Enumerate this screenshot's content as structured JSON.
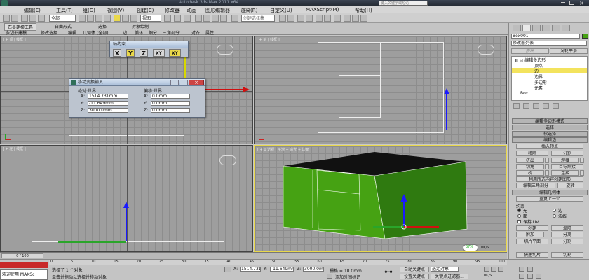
{
  "app": {
    "title": "Autodesk 3ds Max  2011 x64",
    "search_placeholder": "键入关键字或短语"
  },
  "menu": [
    "编辑(E)",
    "工具(T)",
    "组(G)",
    "视图(V)",
    "创建(C)",
    "修改器",
    "动画",
    "图形编辑器",
    "渲染(R)",
    "自定义(U)",
    "MAXScript(M)",
    "帮助(H)"
  ],
  "toolbar": {
    "filter_value": "全部",
    "view_value": "视图",
    "selection_set_placeholder": "创建选择集"
  },
  "ribbon": {
    "tabs": [
      "石墨建模工具",
      "自由形式",
      "选择",
      "对象绘制"
    ],
    "subtabs": [
      "多边形建模",
      "修改选择",
      "编辑",
      "几何体 (全部)",
      "边",
      "循环",
      "细分",
      "三角剖分",
      "对齐",
      "属性"
    ]
  },
  "viewports": [
    {
      "label": "[ + 顶 | 线框 ]"
    },
    {
      "label": "[ + 前 | 线框 ]"
    },
    {
      "label": "[ + 左 | 线框 ]"
    },
    {
      "label": "[ + 0 透视 | 平滑 + 高光 + 边面 ]"
    }
  ],
  "axis_constraints": {
    "title": "轴约束",
    "buttons": [
      "X",
      "Y",
      "Z",
      "XY",
      "XY"
    ]
  },
  "transform_dialog": {
    "title": "移动变换输入",
    "absolute_title": "绝对:世界",
    "offset_title": "偏移:世界",
    "absolute": [
      {
        "axis": "X:",
        "value": "1514.731mm"
      },
      {
        "axis": "Y:",
        "value": "-11.649mm"
      },
      {
        "axis": "Z:",
        "value": "3000.0mm"
      }
    ],
    "offset": [
      {
        "axis": "X:",
        "value": "0.0mm"
      },
      {
        "axis": "Y:",
        "value": "0.0mm"
      },
      {
        "axis": "Z:",
        "value": "0.0mm"
      }
    ]
  },
  "command_panel": {
    "object_name": "Box001",
    "modifier_list": "修改器列表",
    "tab_labels": [
      "挤出",
      "涡轮平滑"
    ],
    "stack": [
      {
        "label": "编辑多边形",
        "level": 0,
        "selected": false
      },
      {
        "label": "顶点",
        "level": 1,
        "selected": false
      },
      {
        "label": "边",
        "level": 1,
        "selected": true
      },
      {
        "label": "边界",
        "level": 1,
        "selected": false
      },
      {
        "label": "多边形",
        "level": 1,
        "selected": false
      },
      {
        "label": "元素",
        "level": 1,
        "selected": false
      },
      {
        "label": "Box",
        "level": 0,
        "selected": false
      }
    ],
    "rollouts": {
      "edit_poly_mode": "编辑多边形模式",
      "selection": "选择",
      "soft_selection": "软选择",
      "edit_edges": "编辑边",
      "insert_vertex": "插入顶点",
      "edge_buttons": [
        [
          "移除",
          "分割"
        ],
        [
          "挤出",
          "焊接"
        ],
        [
          "切角",
          "目标焊接"
        ],
        [
          "桥",
          "连接"
        ]
      ],
      "create_shape": "利用所选内容创建图形",
      "edit_tri": "编辑三角剖分",
      "turn": "旋转",
      "edit_geometry": "编辑几何体",
      "repeat_last": "重复上一个",
      "constraints": "约束",
      "constraint_options": [
        "无",
        "边",
        "面",
        "法线"
      ],
      "preserve_uv": "保持 UV",
      "create": "创建",
      "collapse": "塌陷",
      "attach": "附加",
      "detach": "分离",
      "slice_plane": "切片平面",
      "split": "分割",
      "quick_slice": "快速切片",
      "cut": "切割"
    }
  },
  "statusbar": {
    "welcome": "欢迎使用  MAXSc",
    "status": "选择了 1 个对象",
    "hint": "单击并拖动以选择并移动对象",
    "timeline": "0 / 100",
    "ticks": [
      "0",
      "5",
      "10",
      "15",
      "20",
      "25",
      "30",
      "35",
      "40",
      "45",
      "50",
      "55",
      "60",
      "65",
      "70",
      "75",
      "80",
      "85",
      "90",
      "95",
      "100"
    ],
    "x_value": "1514.731m",
    "y_value": "-11.649mm",
    "z_value": "3000.0mm",
    "grid": "栅格 = 10.0mm",
    "add_time_tag": "添加时间标记",
    "auto_key": "自动关键点",
    "set_key": "设置关键点",
    "selected_object": "选定对象",
    "key_filters": "关键点过滤器...",
    "fps_a": "0K/S",
    "fps_b": "0K/S",
    "percent": "37%"
  },
  "colors": {
    "green_box": "#46a213",
    "active_border": "#e9d84a",
    "axis_y": "#1a1aff",
    "axis_x": "#d01010"
  }
}
